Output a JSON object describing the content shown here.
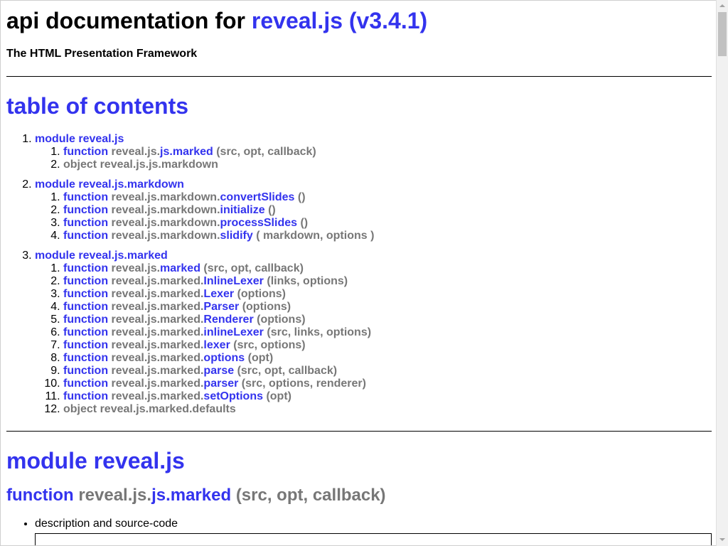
{
  "header": {
    "title_prefix": "api documentation for",
    "title_link": "reveal.js (v3.4.1)",
    "subtitle": "The HTML Presentation Framework"
  },
  "toc": {
    "title": "table of contents",
    "modules": [
      {
        "label": "module reveal.js",
        "items": [
          {
            "kind": "function",
            "prefix": "reveal.js.",
            "name": "js.marked",
            "args": "(src, opt, callback)"
          },
          {
            "kind": "object",
            "text": "object reveal.js.js.markdown"
          }
        ]
      },
      {
        "label": "module reveal.js.markdown",
        "items": [
          {
            "kind": "function",
            "prefix": "reveal.js.markdown.",
            "name": "convertSlides",
            "args": "()"
          },
          {
            "kind": "function",
            "prefix": "reveal.js.markdown.",
            "name": "initialize",
            "args": "()"
          },
          {
            "kind": "function",
            "prefix": "reveal.js.markdown.",
            "name": "processSlides",
            "args": "()"
          },
          {
            "kind": "function",
            "prefix": "reveal.js.markdown.",
            "name": "slidify",
            "args": "( markdown, options )"
          }
        ]
      },
      {
        "label": "module reveal.js.marked",
        "items": [
          {
            "kind": "function",
            "prefix": "reveal.js.",
            "name": "marked",
            "args": "(src, opt, callback)"
          },
          {
            "kind": "function",
            "prefix": "reveal.js.marked.",
            "name": "InlineLexer",
            "args": "(links, options)"
          },
          {
            "kind": "function",
            "prefix": "reveal.js.marked.",
            "name": "Lexer",
            "args": "(options)"
          },
          {
            "kind": "function",
            "prefix": "reveal.js.marked.",
            "name": "Parser",
            "args": "(options)"
          },
          {
            "kind": "function",
            "prefix": "reveal.js.marked.",
            "name": "Renderer",
            "args": "(options)"
          },
          {
            "kind": "function",
            "prefix": "reveal.js.marked.",
            "name": "inlineLexer",
            "args": "(src, links, options)"
          },
          {
            "kind": "function",
            "prefix": "reveal.js.marked.",
            "name": "lexer",
            "args": "(src, options)"
          },
          {
            "kind": "function",
            "prefix": "reveal.js.marked.",
            "name": "options",
            "args": "(opt)"
          },
          {
            "kind": "function",
            "prefix": "reveal.js.marked.",
            "name": "parse",
            "args": "(src, opt, callback)"
          },
          {
            "kind": "function",
            "prefix": "reveal.js.marked.",
            "name": "parser",
            "args": "(src, options, renderer)"
          },
          {
            "kind": "function",
            "prefix": "reveal.js.marked.",
            "name": "setOptions",
            "args": "(opt)"
          },
          {
            "kind": "object",
            "text": "object reveal.js.marked.defaults"
          }
        ]
      }
    ]
  },
  "section": {
    "module_heading": "module reveal.js",
    "fn_keyword": "function",
    "fn_prefix": "reveal.js.",
    "fn_name": "js.marked",
    "fn_args": "(src, opt, callback)",
    "desc_item": "description and source-code"
  },
  "labels": {
    "function_keyword": "function"
  }
}
